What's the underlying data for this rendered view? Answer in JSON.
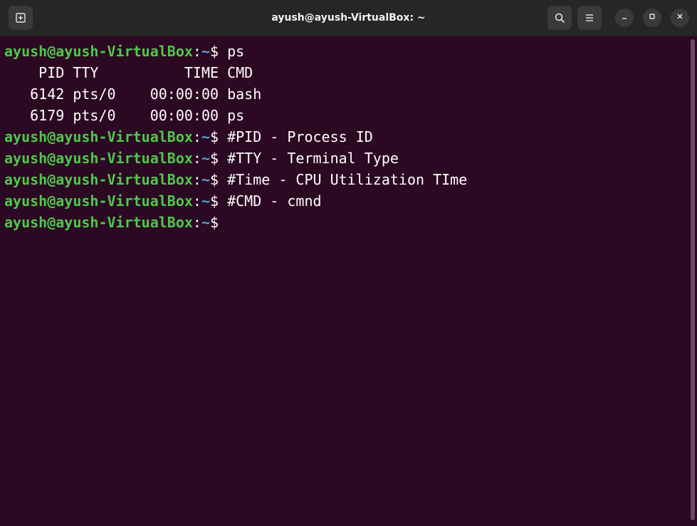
{
  "window": {
    "title": "ayush@ayush-VirtualBox: ~"
  },
  "titlebar": {
    "new_tab_icon": "new-tab-icon",
    "search_icon": "search-icon",
    "menu_icon": "hamburger-menu-icon",
    "minimize_icon": "minimize-icon",
    "maximize_icon": "maximize-icon",
    "close_icon": "close-icon"
  },
  "colors": {
    "background": "#2c0922",
    "titlebar": "#262626",
    "user_host": "#4ec94a",
    "path": "#5a9fd8",
    "text": "#ffffff"
  },
  "terminal": {
    "prompt": {
      "user_host": "ayush@ayush-VirtualBox",
      "separator": ":",
      "path": "~",
      "symbol": "$"
    },
    "lines": [
      {
        "type": "prompt",
        "command": " ps"
      },
      {
        "type": "output",
        "text": "    PID TTY          TIME CMD"
      },
      {
        "type": "output",
        "text": "   6142 pts/0    00:00:00 bash"
      },
      {
        "type": "output",
        "text": "   6179 pts/0    00:00:00 ps"
      },
      {
        "type": "prompt",
        "command": " #PID - Process ID"
      },
      {
        "type": "prompt",
        "command": " #TTY - Terminal Type"
      },
      {
        "type": "prompt",
        "command": " #Time - CPU Utilization TIme"
      },
      {
        "type": "prompt",
        "command": " #CMD - cmnd"
      },
      {
        "type": "prompt",
        "command": ""
      }
    ]
  }
}
